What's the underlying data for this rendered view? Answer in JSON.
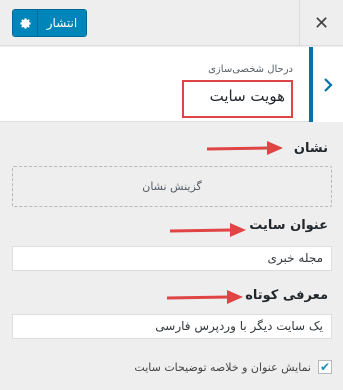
{
  "topbar": {
    "publish_label": "انتشار",
    "settings_icon": "gear-icon",
    "close_icon": "close-icon"
  },
  "section": {
    "breadcrumb": "درحال شخصی‌سازی",
    "title": "هویت سایت",
    "back_icon": "chevron-right-icon"
  },
  "logo": {
    "label": "نشان",
    "button_label": "گزینش نشان"
  },
  "site_title": {
    "label": "عنوان سایت",
    "value": "مجله خبری"
  },
  "tagline": {
    "label": "معرفی کوتاه",
    "value": "یک سایت دیگر با وردپرس فارسی"
  },
  "display": {
    "checkbox_label": "نمایش عنوان و خلاصه توضیحات سایت",
    "checked": true
  },
  "colors": {
    "accent": "#0085ba",
    "annotation": "#e04444"
  }
}
